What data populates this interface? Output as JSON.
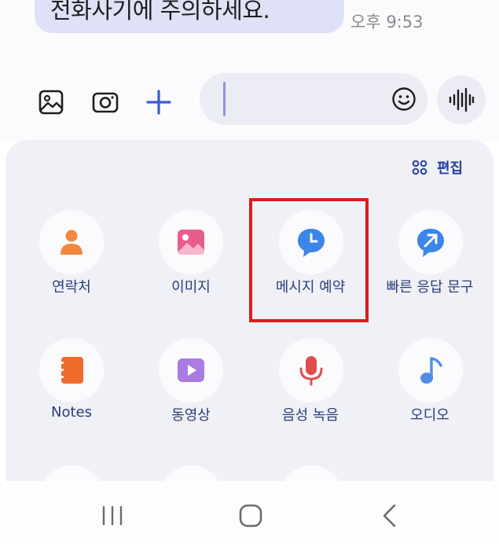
{
  "message": {
    "text": "전화사기에 주의하세요.",
    "time": "오후 9:53"
  },
  "composer": {
    "tools": [
      {
        "icon": "image-icon"
      },
      {
        "icon": "camera-icon"
      },
      {
        "icon": "plus-icon"
      }
    ],
    "emoji_icon": "emoji-icon",
    "voice_icon": "voice-waveform-icon",
    "accent_color": "#3a5bd6"
  },
  "panel": {
    "edit_label": "편집",
    "items": [
      {
        "label": "연락처",
        "icon": "contact-icon",
        "color": "#f2883f"
      },
      {
        "label": "이미지",
        "icon": "image-icon",
        "color": "#e95c8e"
      },
      {
        "label": "메시지 예약",
        "icon": "scheduled-message-icon",
        "color": "#3b86e8"
      },
      {
        "label": "빠른 응답 문구",
        "icon": "quick-reply-icon",
        "color": "#3b86e8"
      },
      {
        "label": "Notes",
        "icon": "notes-icon",
        "color": "#f06a2a"
      },
      {
        "label": "동영상",
        "icon": "video-icon",
        "color": "#a97be3"
      },
      {
        "label": "음성 녹음",
        "icon": "microphone-icon",
        "color": "#e04d4d"
      },
      {
        "label": "오디오",
        "icon": "music-note-icon",
        "color": "#4d8de8"
      }
    ],
    "highlight_color": "#e01b1b"
  },
  "navbar": {
    "items": [
      {
        "icon": "recent-apps-icon"
      },
      {
        "icon": "home-icon"
      },
      {
        "icon": "back-icon"
      }
    ]
  }
}
